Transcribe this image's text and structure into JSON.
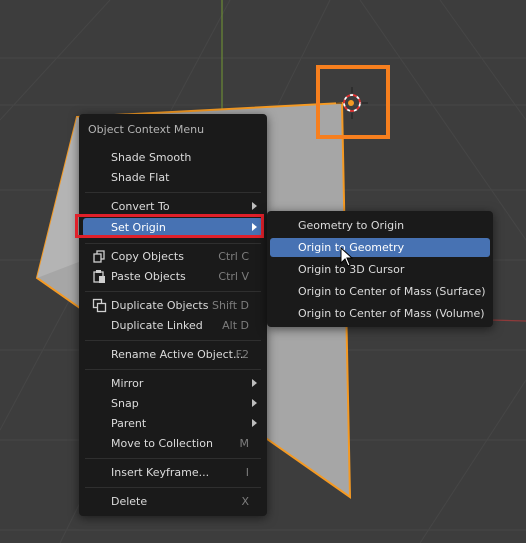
{
  "context_menu": {
    "title": "Object Context Menu",
    "items": [
      {
        "label": "Shade Smooth"
      },
      {
        "label": "Shade Flat"
      },
      {
        "label": "Convert To"
      },
      {
        "label": "Set Origin"
      },
      {
        "label": "Copy Objects",
        "shortcut": "Ctrl C"
      },
      {
        "label": "Paste Objects",
        "shortcut": "Ctrl V"
      },
      {
        "label": "Duplicate Objects",
        "shortcut": "Shift D"
      },
      {
        "label": "Duplicate Linked",
        "shortcut": "Alt D"
      },
      {
        "label": "Rename Active Object...",
        "shortcut": "F2"
      },
      {
        "label": "Mirror"
      },
      {
        "label": "Snap"
      },
      {
        "label": "Parent"
      },
      {
        "label": "Move to Collection",
        "shortcut": "M"
      },
      {
        "label": "Insert Keyframe...",
        "shortcut": "I"
      },
      {
        "label": "Delete",
        "shortcut": "X"
      }
    ]
  },
  "set_origin_submenu": {
    "items": [
      {
        "label": "Geometry to Origin"
      },
      {
        "label": "Origin to Geometry"
      },
      {
        "label": "Origin to 3D Cursor"
      },
      {
        "label": "Origin to Center of Mass (Surface)"
      },
      {
        "label": "Origin to Center of Mass (Volume)"
      }
    ]
  },
  "colors": {
    "viewport_bg": "#3d3d3d",
    "menu_bg": "#1a1a1a",
    "active_item": "#4772b3",
    "selection_outline": "#f59a23",
    "highlight_box_red": "#e0202a",
    "highlight_box_orange": "#f77f1e"
  }
}
